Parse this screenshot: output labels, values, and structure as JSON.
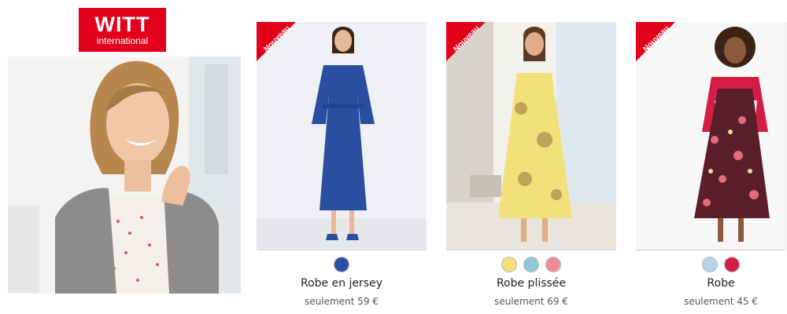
{
  "brand": {
    "name": "WITT",
    "sub": "international"
  },
  "products": [
    {
      "badge": "Nouveau",
      "name": "Robe en jersey",
      "price": "seulement 59 €",
      "swatches": [
        "#2a4ea0"
      ]
    },
    {
      "badge": "Nouveau",
      "name": "Robe plissée",
      "price": "seulement 69 €",
      "swatches": [
        "#f2e07a",
        "#8ec7d6",
        "#ef8c96"
      ]
    },
    {
      "badge": "Nouveau",
      "name": "Robe",
      "price": "seulement 45 €",
      "swatches": [
        "#b8d3e6",
        "#d31d45"
      ]
    }
  ],
  "colors": {
    "brand_red": "#e2001a",
    "text": "#222222",
    "price_text": "#555555"
  }
}
